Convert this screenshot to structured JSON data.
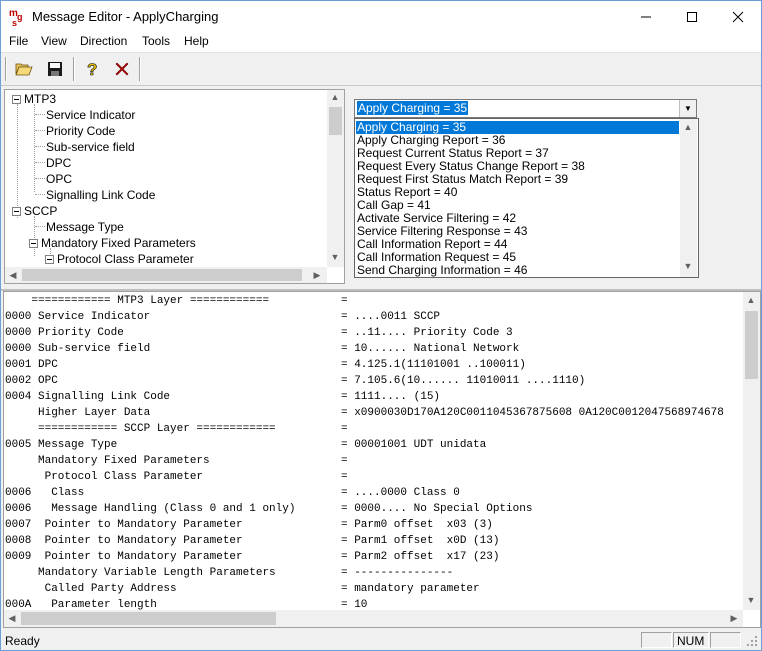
{
  "window": {
    "title": "Message Editor - ApplyCharging"
  },
  "menu": [
    "File",
    "View",
    "Direction",
    "Tools",
    "Help"
  ],
  "toolbar": {
    "buttons": [
      {
        "name": "open-button",
        "icon": "folder-open-icon"
      },
      {
        "name": "save-button",
        "icon": "floppy-disk-icon"
      },
      {
        "name": "help-button",
        "icon": "help-question-icon"
      },
      {
        "name": "close-button",
        "icon": "red-x-icon"
      }
    ]
  },
  "tree": {
    "mtp3": "MTP3",
    "mtp3_children": [
      "Service Indicator",
      "Priority Code",
      "Sub-service field",
      "DPC",
      "OPC",
      "Signalling Link Code"
    ],
    "sccp": "SCCP",
    "message_type": "Message Type",
    "mandatory_fixed": "Mandatory Fixed Parameters",
    "protocol_class": "Protocol Class Parameter"
  },
  "combo": {
    "selected": "Apply Charging = 35",
    "options": [
      "Apply Charging = 35",
      "Apply Charging Report = 36",
      "Request Current Status Report = 37",
      "Request Every Status Change Report = 38",
      "Request First Status Match Report = 39",
      "Status Report = 40",
      "Call Gap = 41",
      "Activate Service Filtering = 42",
      "Service Filtering Response = 43",
      "Call Information Report = 44",
      "Call Information Request = 45",
      "Send Charging Information = 46"
    ]
  },
  "decode": [
    {
      "l": "    ============ MTP3 Layer ============",
      "r": "="
    },
    {
      "l": "0000 Service Indicator",
      "r": "= ....0011 SCCP"
    },
    {
      "l": "0000 Priority Code",
      "r": "= ..11.... Priority Code 3"
    },
    {
      "l": "0000 Sub-service field",
      "r": "= 10...... National Network"
    },
    {
      "l": "0001 DPC",
      "r": "= 4.125.1(11101001 ..100011)"
    },
    {
      "l": "0002 OPC",
      "r": "= 7.105.6(10...... 11010011 ....1110)"
    },
    {
      "l": "0004 Signalling Link Code",
      "r": "= 1111.... (15)"
    },
    {
      "l": "     Higher Layer Data",
      "r": "= x0900030D170A120C0011045367875608 0A120C0012047568974678"
    },
    {
      "l": "     ============ SCCP Layer ============",
      "r": "="
    },
    {
      "l": "0005 Message Type",
      "r": "= 00001001 UDT unidata"
    },
    {
      "l": "     Mandatory Fixed Parameters",
      "r": "="
    },
    {
      "l": "      Protocol Class Parameter",
      "r": "="
    },
    {
      "l": "0006   Class",
      "r": "= ....0000 Class 0"
    },
    {
      "l": "0006   Message Handling (Class 0 and 1 only)",
      "r": "= 0000.... No Special Options"
    },
    {
      "l": "0007  Pointer to Mandatory Parameter",
      "r": "= Parm0 offset  x03 (3)"
    },
    {
      "l": "0008  Pointer to Mandatory Parameter",
      "r": "= Parm1 offset  x0D (13)"
    },
    {
      "l": "0009  Pointer to Mandatory Parameter",
      "r": "= Parm2 offset  x17 (23)"
    },
    {
      "l": "     Mandatory Variable Length Parameters",
      "r": "= ---------------"
    },
    {
      "l": "      Called Party Address",
      "r": "= mandatory parameter"
    },
    {
      "l": "000A   Parameter length",
      "r": "= 10"
    }
  ],
  "status": {
    "text": "Ready",
    "num": "NUM"
  }
}
